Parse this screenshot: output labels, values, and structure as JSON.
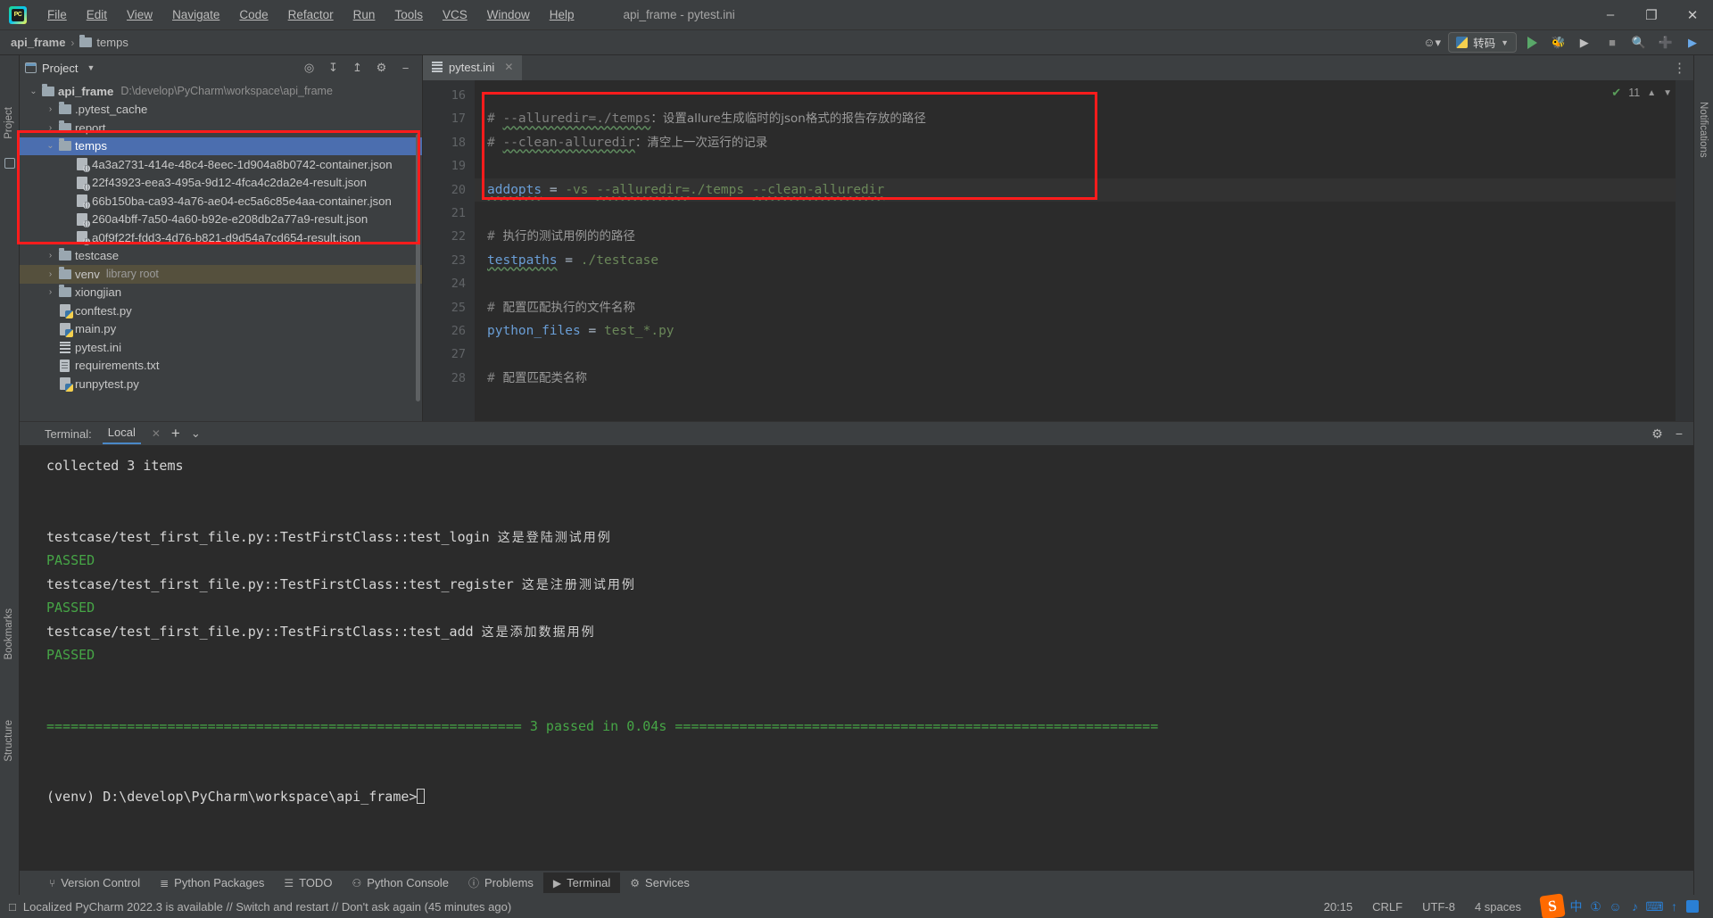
{
  "titlebar": {
    "logo_text": "PC",
    "menus": [
      "File",
      "Edit",
      "View",
      "Navigate",
      "Code",
      "Refactor",
      "Run",
      "Tools",
      "VCS",
      "Window",
      "Help"
    ],
    "window_title": "api_frame - pytest.ini",
    "minimize": "–",
    "maximize": "❐",
    "close": "✕"
  },
  "navbar": {
    "crumbs": [
      "api_frame",
      "temps"
    ],
    "separator": "›",
    "run_config_label": "转码",
    "buttons": {
      "user": "☺",
      "run": "run-triangle",
      "debug": "debug-bug",
      "coverage": "coverage",
      "stop": "stop-square",
      "search": "⌕",
      "updates": "+",
      "assistant": "assistant"
    }
  },
  "project_panel": {
    "title": "Project",
    "tools": [
      "⊕",
      "⤓",
      "⇱",
      "⚙",
      "−"
    ],
    "tree": [
      {
        "indent": 0,
        "arrow": "⌄",
        "icon": "folder",
        "label": "api_frame",
        "bold": true,
        "note": "D:\\develop\\PyCharm\\workspace\\api_frame",
        "state": "normal"
      },
      {
        "indent": 1,
        "arrow": "›",
        "icon": "folder",
        "label": ".pytest_cache",
        "bold": false,
        "note": "",
        "state": "normal"
      },
      {
        "indent": 1,
        "arrow": "›",
        "icon": "folder",
        "label": "report",
        "bold": false,
        "note": "",
        "state": "normal"
      },
      {
        "indent": 1,
        "arrow": "⌄",
        "icon": "folder",
        "label": "temps",
        "bold": false,
        "note": "",
        "state": "selected"
      },
      {
        "indent": 2,
        "arrow": "",
        "icon": "json",
        "label": "4a3a2731-414e-48c4-8eec-1d904a8b0742-container.json",
        "bold": false,
        "note": "",
        "state": "normal"
      },
      {
        "indent": 2,
        "arrow": "",
        "icon": "json",
        "label": "22f43923-eea3-495a-9d12-4fca4c2da2e4-result.json",
        "bold": false,
        "note": "",
        "state": "normal"
      },
      {
        "indent": 2,
        "arrow": "",
        "icon": "json",
        "label": "66b150ba-ca93-4a76-ae04-ec5a6c85e4aa-container.json",
        "bold": false,
        "note": "",
        "state": "normal"
      },
      {
        "indent": 2,
        "arrow": "",
        "icon": "json",
        "label": "260a4bff-7a50-4a60-b92e-e208db2a77a9-result.json",
        "bold": false,
        "note": "",
        "state": "normal"
      },
      {
        "indent": 2,
        "arrow": "",
        "icon": "json",
        "label": "a0f9f22f-fdd3-4d76-b821-d9d54a7cd654-result.json",
        "bold": false,
        "note": "",
        "state": "normal"
      },
      {
        "indent": 1,
        "arrow": "›",
        "icon": "folder",
        "label": "testcase",
        "bold": false,
        "note": "",
        "state": "normal"
      },
      {
        "indent": 1,
        "arrow": "›",
        "icon": "folder",
        "label": "venv",
        "bold": false,
        "note": "library root",
        "state": "venv"
      },
      {
        "indent": 1,
        "arrow": "›",
        "icon": "folder",
        "label": "xiongjian",
        "bold": false,
        "note": "",
        "state": "normal"
      },
      {
        "indent": 1,
        "arrow": "",
        "icon": "py",
        "label": "conftest.py",
        "bold": false,
        "note": "",
        "state": "normal"
      },
      {
        "indent": 1,
        "arrow": "",
        "icon": "py",
        "label": "main.py",
        "bold": false,
        "note": "",
        "state": "normal"
      },
      {
        "indent": 1,
        "arrow": "",
        "icon": "ini",
        "label": "pytest.ini",
        "bold": false,
        "note": "",
        "state": "normal"
      },
      {
        "indent": 1,
        "arrow": "",
        "icon": "txt",
        "label": "requirements.txt",
        "bold": false,
        "note": "",
        "state": "normal"
      },
      {
        "indent": 1,
        "arrow": "",
        "icon": "py",
        "label": "runpytest.py",
        "bold": false,
        "note": "",
        "state": "normal"
      }
    ]
  },
  "editor": {
    "tab_label": "pytest.ini",
    "tab_close": "✕",
    "inspection_count": "11",
    "inspection_check": "✔",
    "lines": [
      {
        "num": "16",
        "segments": [],
        "highlight": false
      },
      {
        "num": "17",
        "segments": [
          {
            "text": "# ",
            "cls": "cmt"
          },
          {
            "text": "--alluredir=./temps",
            "cls": "cmt sq"
          },
          {
            "text": "：设置allure生成临时的json格式的报告存放的路径",
            "cls": "cn-cmt"
          }
        ],
        "highlight": false
      },
      {
        "num": "18",
        "segments": [
          {
            "text": "# ",
            "cls": "cmt"
          },
          {
            "text": "--clean-alluredir",
            "cls": "cmt sq"
          },
          {
            "text": "：清空上一次运行的记录",
            "cls": "cn-cmt"
          }
        ],
        "highlight": false
      },
      {
        "num": "19",
        "segments": [],
        "highlight": false
      },
      {
        "num": "20",
        "segments": [
          {
            "text": "addopts",
            "cls": "key2 sq"
          },
          {
            "text": " = ",
            "cls": "eq"
          },
          {
            "text": "-vs ",
            "cls": "val"
          },
          {
            "text": "--alluredir=",
            "cls": "val sq"
          },
          {
            "text": "./temps ",
            "cls": "val"
          },
          {
            "text": "--clean-alluredir",
            "cls": "val sq"
          }
        ],
        "highlight": true
      },
      {
        "num": "21",
        "segments": [],
        "highlight": false
      },
      {
        "num": "22",
        "segments": [
          {
            "text": "# ",
            "cls": "cmt"
          },
          {
            "text": "执行的测试用例的的路径",
            "cls": "cn-cmt"
          }
        ],
        "highlight": false
      },
      {
        "num": "23",
        "segments": [
          {
            "text": "testpaths",
            "cls": "key2 sq"
          },
          {
            "text": " = ",
            "cls": "eq"
          },
          {
            "text": "./testcase",
            "cls": "val"
          }
        ],
        "highlight": false
      },
      {
        "num": "24",
        "segments": [],
        "highlight": false
      },
      {
        "num": "25",
        "segments": [
          {
            "text": "# ",
            "cls": "cmt"
          },
          {
            "text": "配置匹配执行的文件名称",
            "cls": "cn-cmt"
          }
        ],
        "highlight": false
      },
      {
        "num": "26",
        "segments": [
          {
            "text": "python_files",
            "cls": "key2"
          },
          {
            "text": " = ",
            "cls": "eq"
          },
          {
            "text": "test_*.py",
            "cls": "val"
          }
        ],
        "highlight": false
      },
      {
        "num": "27",
        "segments": [],
        "highlight": false
      },
      {
        "num": "28",
        "segments": [
          {
            "text": "# ",
            "cls": "cmt"
          },
          {
            "text": "配置匹配类名称",
            "cls": "cn-cmt"
          }
        ],
        "highlight": false
      }
    ]
  },
  "terminal": {
    "label": "Terminal:",
    "tab": "Local",
    "tab_close": "✕",
    "add": "+",
    "chevron": "⌄",
    "gear": "⚙",
    "minimize": "−",
    "lines": [
      {
        "segments": [
          {
            "text": "collected 3 items",
            "cls": ""
          }
        ]
      },
      {
        "segments": []
      },
      {
        "segments": []
      },
      {
        "segments": [
          {
            "text": "testcase/test_first_file.py::TestFirstClass::test_login ",
            "cls": ""
          },
          {
            "text": "这是登陆测试用例",
            "cls": "cn"
          }
        ]
      },
      {
        "segments": [
          {
            "text": "PASSED",
            "cls": "green"
          }
        ]
      },
      {
        "segments": [
          {
            "text": "testcase/test_first_file.py::TestFirstClass::test_register ",
            "cls": ""
          },
          {
            "text": "这是注册测试用例",
            "cls": "cn"
          }
        ]
      },
      {
        "segments": [
          {
            "text": "PASSED",
            "cls": "green"
          }
        ]
      },
      {
        "segments": [
          {
            "text": "testcase/test_first_file.py::TestFirstClass::test_add ",
            "cls": ""
          },
          {
            "text": "这是添加数据用例",
            "cls": "cn"
          }
        ]
      },
      {
        "segments": [
          {
            "text": "PASSED",
            "cls": "green"
          }
        ]
      },
      {
        "segments": []
      },
      {
        "segments": []
      },
      {
        "segments": [
          {
            "text": "=========================================================== 3 passed in 0.04s ============================================================",
            "cls": "green"
          }
        ]
      },
      {
        "segments": []
      },
      {
        "segments": []
      },
      {
        "segments": [
          {
            "text": "(venv) D:\\develop\\PyCharm\\workspace\\api_frame>",
            "cls": ""
          },
          {
            "text": "",
            "cls": "caret-slot"
          }
        ]
      }
    ]
  },
  "left_rail": {
    "project_label": "Project",
    "bookmarks_label": "Bookmarks",
    "structure_label": "Structure"
  },
  "right_rail": {
    "notifications_label": "Notifications"
  },
  "tool_windows": [
    {
      "icon": "⑂",
      "label": "Version Control",
      "active": false
    },
    {
      "icon": "≣",
      "label": "Python Packages",
      "active": false
    },
    {
      "icon": "☰",
      "label": "TODO",
      "active": false
    },
    {
      "icon": "⚇",
      "label": "Python Console",
      "active": false
    },
    {
      "icon": "ⓘ",
      "label": "Problems",
      "active": false
    },
    {
      "icon": "▶",
      "label": "Terminal",
      "active": true
    },
    {
      "icon": "⚙",
      "label": "Services",
      "active": false
    }
  ],
  "statusbar": {
    "notice_icon": "□",
    "notice": "Localized PyCharm 2022.3 is available // Switch and restart // Don't ask again (45 minutes ago)",
    "caret_position": "20:15",
    "line_separator": "CRLF",
    "encoding": "UTF-8",
    "indent": "4 spaces",
    "tray": {
      "sogou": "S",
      "ime": "中",
      "extras": [
        "①",
        "☺",
        "♪",
        "⌨",
        "↑",
        "▦"
      ]
    }
  },
  "annotations": {
    "box_tree": "red-highlight-around-temps-folder",
    "box_code": "red-highlight-around-addopts-block"
  },
  "colors": {
    "accent_blue": "#4b6eaf",
    "annotation_red": "#ff1c1c",
    "pass_green": "#46a546",
    "panel_bg": "#3c3f41",
    "editor_bg": "#2b2b2b"
  }
}
